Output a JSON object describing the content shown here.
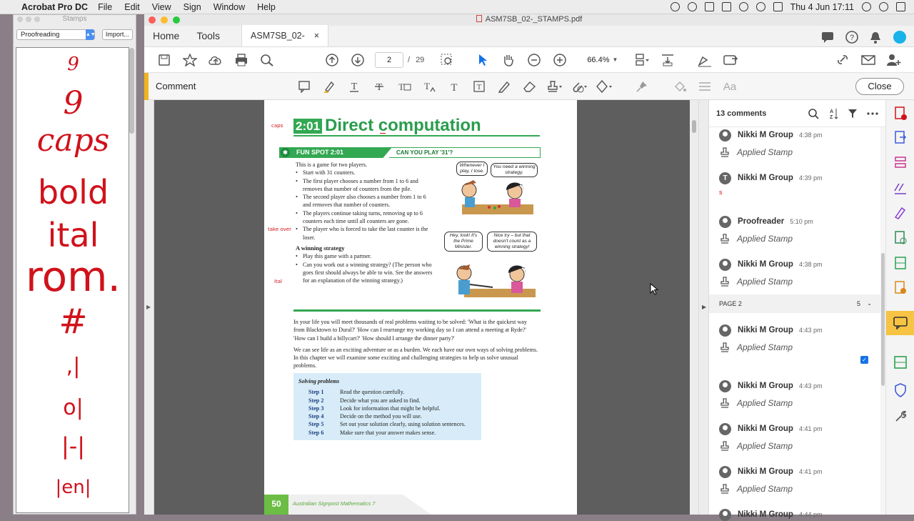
{
  "menubar": {
    "app_name": "Acrobat Pro DC",
    "items": [
      "File",
      "Edit",
      "View",
      "Sign",
      "Window",
      "Help"
    ],
    "clock": "Thu 4 Jun  17:11"
  },
  "stamps_palette": {
    "title": "Stamps",
    "category": "Proofreading",
    "import_label": "Import...",
    "marks": [
      "9",
      "9",
      "caps",
      "bold",
      "ital",
      "rom.",
      "#",
      ",|",
      "o|",
      "|-|",
      "|en|"
    ]
  },
  "window": {
    "title": "ASM7SB_02-_STAMPS.pdf",
    "tabs": {
      "home": "Home",
      "tools": "Tools",
      "document": "ASM7SB_02-_ST...",
      "close": "×"
    },
    "page_current": "2",
    "page_sep": "/",
    "page_total": "29",
    "zoom": "66.4%",
    "comment_label": "Comment",
    "close_label": "Close"
  },
  "document": {
    "chapter_num": "2:01",
    "chapter_title": "Direct computation",
    "fun_spot": "FUN SPOT 2:01",
    "fun_spot_question": "CAN YOU PLAY '31'?",
    "intro": "This is a game for two players.",
    "rules": [
      "Start with 31 counters.",
      "The first player chooses a number from 1 to 6 and removes that number of counters from the pile.",
      "The second player also chooses a number from 1 to 6 and removes that number of counters.",
      "The players continue taking turns, removing up to 6 counters each time until all counters are gone.",
      "The player who is forced to take the last counter is the loser."
    ],
    "winning_heading": "A winning strategy",
    "winning_items": [
      "Play this game with a partner.",
      "Can you work out a winning strategy? (The person who goes first should always be able to win. See the answers for an explanation of the winning strategy.)"
    ],
    "bubbles": [
      "Whenever I play, I lose.",
      "You need a winning strategy.",
      "Hey, look! It's the Prime Minister.",
      "Nice try – but that doesn't count as a winning strategy!"
    ],
    "para1": "In your life you will meet thousands of real problems waiting to be solved: 'What is the quickest way from Blacktown to Dural?' 'How can I rearrange my working day so I can attend a meeting at Ryde?' 'How can I build a billycart?' 'How should I arrange the dinner party?'",
    "para2": "We can see life as an exciting adventure or as a burden. We each have our own ways of solving problems. In this chapter we will examine some exciting and challenging strategies to help us solve unusual problems.",
    "steps_title": "Solving problems",
    "steps": [
      {
        "k": "Step 1",
        "v": "Read the question carefully."
      },
      {
        "k": "Step 2",
        "v": "Decide what you are asked to find."
      },
      {
        "k": "Step 3",
        "v": "Look for information that might be helpful."
      },
      {
        "k": "Step 4",
        "v": "Decide on the method you will use."
      },
      {
        "k": "Step 5",
        "v": "Set out your solution clearly, using solution sentences."
      },
      {
        "k": "Step 6",
        "v": "Make sure that your answer makes sense."
      }
    ],
    "page_number": "50",
    "footer_text": "Australian Signpost Mathematics 7",
    "margin_marks": {
      "caps": "caps",
      "take_over": "take over",
      "ital": "ital"
    }
  },
  "comments": {
    "count_label": "13 comments",
    "items": [
      {
        "name": "Nikki M Group",
        "time": "4:38 pm",
        "text": "Applied Stamp"
      },
      {
        "name": "Nikki M Group",
        "time": "4:39 pm",
        "text": "s"
      },
      {
        "name": "Proofreader",
        "time": "5:10 pm",
        "text": "Applied Stamp"
      },
      {
        "name": "Nikki M Group",
        "time": "4:38 pm",
        "text": "Applied Stamp"
      },
      {
        "name": "Nikki M Group",
        "time": "4:43 pm",
        "text": "Applied Stamp"
      },
      {
        "name": "Nikki M Group",
        "time": "4:43 pm",
        "text": "Applied Stamp"
      },
      {
        "name": "Nikki M Group",
        "time": "4:41 pm",
        "text": "Applied Stamp"
      },
      {
        "name": "Nikki M Group",
        "time": "4:41 pm",
        "text": "Applied Stamp"
      },
      {
        "name": "Nikki M Group",
        "time": "4:44 pm",
        "text": ""
      }
    ],
    "page_header": "PAGE 2",
    "page_count": "5"
  },
  "colors": {
    "accent": "#f0b321",
    "brand_green": "#33a852",
    "stamp_red": "#d0121b",
    "adobe_blue": "#1473e6"
  }
}
